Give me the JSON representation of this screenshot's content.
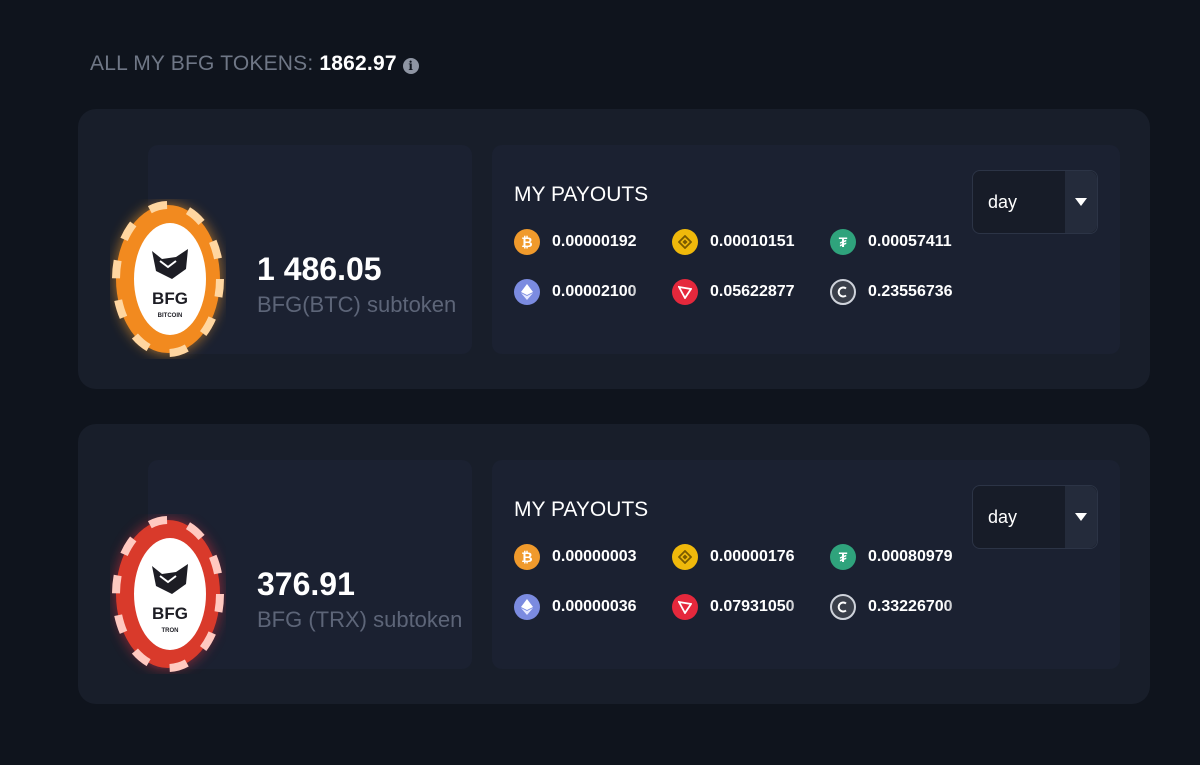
{
  "header": {
    "label": "ALL MY BFG TOKENS:",
    "value": "1862.97"
  },
  "cards": [
    {
      "amount": "1 486.05",
      "name": "BFG(BTC) subtoken",
      "chip": {
        "text": "BFG",
        "sub": "BITCOIN",
        "color": "#f28a1f",
        "glow": "#f59b2b"
      },
      "payouts_title": "MY PAYOUTS",
      "period": "day",
      "payouts": [
        {
          "coin": "bitcoin-icon",
          "color": "#f09a2c",
          "value": "0.00000192"
        },
        {
          "coin": "bnb-icon",
          "color": "#f0b90b",
          "value": "0.00010151"
        },
        {
          "coin": "tether-icon",
          "color": "#2fa37c",
          "value": "0.00057411"
        },
        {
          "coin": "ethereum-icon",
          "color": "#7b8be0",
          "value": "0.00002100"
        },
        {
          "coin": "tron-icon",
          "color": "#e5283c",
          "value": "0.05622877"
        },
        {
          "coin": "bfg-coin-icon",
          "color": "#3a3f4a",
          "value": "0.23556736"
        }
      ]
    },
    {
      "amount": "376.91",
      "name": "BFG (TRX) subtoken",
      "chip": {
        "text": "BFG",
        "sub": "TRON",
        "color": "#d93a2b",
        "glow": "#c92d3a"
      },
      "payouts_title": "MY PAYOUTS",
      "period": "day",
      "payouts": [
        {
          "coin": "bitcoin-icon",
          "color": "#f09a2c",
          "value": "0.00000003"
        },
        {
          "coin": "bnb-icon",
          "color": "#f0b90b",
          "value": "0.00000176"
        },
        {
          "coin": "tether-icon",
          "color": "#2fa37c",
          "value": "0.00080979"
        },
        {
          "coin": "ethereum-icon",
          "color": "#7b8be0",
          "value": "0.00000036"
        },
        {
          "coin": "tron-icon",
          "color": "#e5283c",
          "value": "0.07931050"
        },
        {
          "coin": "bfg-coin-icon",
          "color": "#3a3f4a",
          "value": "0.33226700"
        }
      ]
    }
  ]
}
